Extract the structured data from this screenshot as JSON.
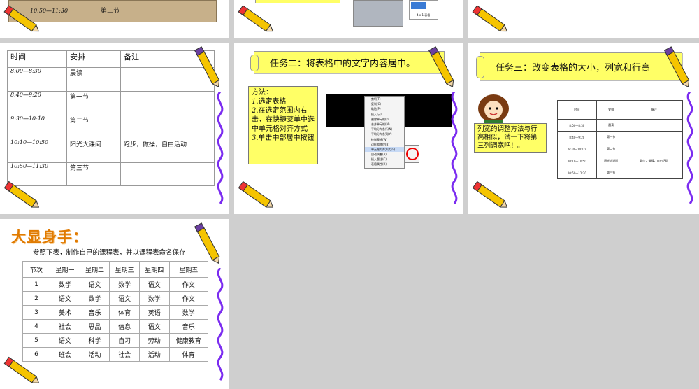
{
  "top_left_slide": {
    "time": "10:50—11:30",
    "period": "第三节"
  },
  "schedule_slide": {
    "headers": [
      "时间",
      "安排",
      "备注"
    ],
    "rows": [
      {
        "time": "8:00—8:30",
        "plan": "晨读",
        "note": ""
      },
      {
        "time": "8:40—9:20",
        "plan": "第一节",
        "note": ""
      },
      {
        "time": "9:30—10:10",
        "plan": "第二节",
        "note": ""
      },
      {
        "time": "10:10—10:50",
        "plan": "阳光大课间",
        "note": "跑步，做操，自由活动"
      },
      {
        "time": "10:50—11:30",
        "plan": "第三节",
        "note": ""
      }
    ]
  },
  "task2_slide": {
    "title": "任务二：将表格中的文字内容居中。",
    "method_title": "方法：",
    "steps": [
      {
        "num": "1.",
        "text": "选定表格"
      },
      {
        "num": "2.",
        "text": "在选定范围内右击，在快捷菜单中选中单元格对齐方式"
      },
      {
        "num": "3.",
        "text": "单击中部居中按钮"
      }
    ],
    "menu_items": [
      "剪切(T)",
      "复制(C)",
      "粘贴(P)",
      "插入行(I)",
      "删除单元格(D)",
      "合并单元格(M)",
      "平均分布各行(N)",
      "平均分布各列(Y)",
      "绘制表格(W)",
      "边框和底纹(B)",
      "单元格对齐方式(G)",
      "自动调整(A)",
      "插入题注(C)",
      "表格属性(R)"
    ]
  },
  "task3_slide": {
    "title": "任务三：改变表格的大小，列宽和行高",
    "hint": "列宽的调整方法与行高相似，试一下将第三列调宽吧！。",
    "table_headers": [
      "时间",
      "安排",
      "备注"
    ],
    "table_rows": [
      [
        "8:00—8:30",
        "晨读",
        ""
      ],
      [
        "8:40—9:20",
        "第一节",
        ""
      ],
      [
        "9:30—10:10",
        "第二节",
        ""
      ],
      [
        "10:10—10:50",
        "阳光大课间",
        "跑步，做操，自由活动"
      ],
      [
        "10:50—11:30",
        "第三节",
        ""
      ]
    ]
  },
  "class_slide": {
    "title": "大显身手：",
    "subtitle": "参照下表，制作自己的课程表，并以课程表命名保存",
    "headers": [
      "节次",
      "星期一",
      "星期二",
      "星期三",
      "星期四",
      "星期五"
    ],
    "rows": [
      [
        "1",
        "数学",
        "语文",
        "数学",
        "语文",
        "作文"
      ],
      [
        "2",
        "语文",
        "数学",
        "语文",
        "数学",
        "作文"
      ],
      [
        "3",
        "美术",
        "音乐",
        "体育",
        "英语",
        "数学"
      ],
      [
        "4",
        "社会",
        "思品",
        "信息",
        "语文",
        "音乐"
      ],
      [
        "5",
        "语文",
        "科学",
        "自习",
        "劳动",
        "健康教育"
      ],
      [
        "6",
        "班会",
        "活动",
        "社会",
        "活动",
        "体育"
      ]
    ]
  },
  "colors": {
    "banner": "#ffff66",
    "title_orange": "#e07a00",
    "squiggle": "#7b2cf0"
  }
}
